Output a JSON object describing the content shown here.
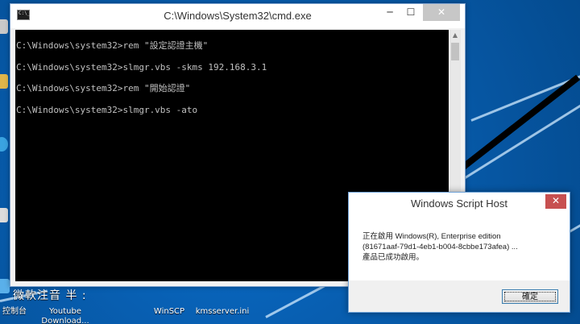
{
  "cmd": {
    "title": "C:\\Windows\\System32\\cmd.exe",
    "close_glyph": "✕",
    "min_glyph": "─",
    "max_glyph": "☐",
    "lines": [
      "C:\\Windows\\system32>rem \"設定認證主機\"",
      "C:\\Windows\\system32>slmgr.vbs -skms 192.168.3.1",
      "C:\\Windows\\system32>rem \"開始認證\"",
      "C:\\Windows\\system32>slmgr.vbs -ato"
    ],
    "scroll_up": "▲",
    "scroll_down": "▼"
  },
  "dialog": {
    "title": "Windows Script Host",
    "close_glyph": "✕",
    "message_lines": [
      "正在啟用 Windows(R), Enterprise edition",
      "(81671aaf-79d1-4eb1-b004-8cbbe173afea) ...",
      "產品已成功啟用。"
    ],
    "ok_label": "確定"
  },
  "desktop": {
    "ime_text": "微軟注音 半 :",
    "icons": [
      {
        "label": "控制台"
      },
      {
        "label": "Youtube Download..."
      },
      {
        "label": "WinSCP"
      },
      {
        "label": "kmsserver.ini"
      }
    ],
    "colors": {
      "wallpaper": "#075aa9",
      "accent_close": "#c75050"
    }
  }
}
